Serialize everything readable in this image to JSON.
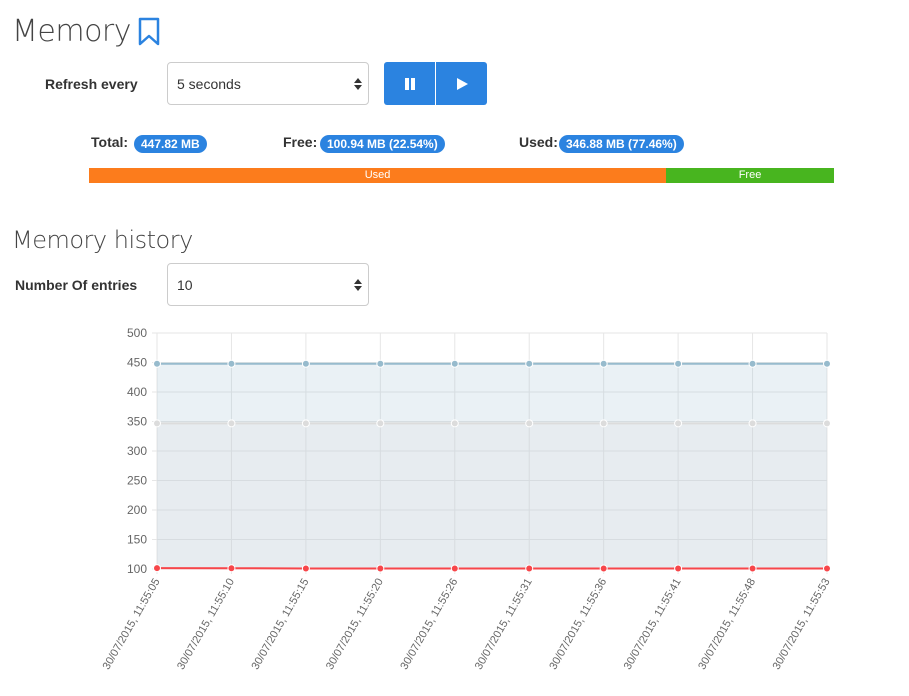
{
  "header": {
    "title": "Memory"
  },
  "refresh": {
    "label": "Refresh every",
    "value": "5 seconds"
  },
  "stats": {
    "total_label": "Total:",
    "total_value": "447.82 MB",
    "free_label": "Free:",
    "free_value": "100.94 MB (22.54%)",
    "used_label": "Used:",
    "used_value": "346.88 MB (77.46%)"
  },
  "usage_bar": {
    "used_label": "Used",
    "free_label": "Free",
    "used_percent": 77.46,
    "free_percent": 22.54
  },
  "history": {
    "title": "Memory history",
    "entries_label": "Number Of entries",
    "entries_value": "10"
  },
  "colors": {
    "accent": "#2b83e0",
    "used": "#fc7c1c",
    "free": "#48b51f"
  },
  "chart_data": {
    "type": "line",
    "x": [
      "30/07/2015, 11:55:05",
      "30/07/2015, 11:55:10",
      "30/07/2015, 11:55:15",
      "30/07/2015, 11:55:20",
      "30/07/2015, 11:55:26",
      "30/07/2015, 11:55:31",
      "30/07/2015, 11:55:36",
      "30/07/2015, 11:55:41",
      "30/07/2015, 11:55:48",
      "30/07/2015, 11:55:53"
    ],
    "ylim": [
      100,
      500
    ],
    "yticks": [
      500,
      450,
      400,
      350,
      300,
      250,
      200,
      150,
      100
    ],
    "grid": true,
    "series": [
      {
        "values": [
          447.82,
          447.82,
          447.82,
          447.82,
          447.82,
          447.82,
          447.82,
          447.82,
          447.82,
          447.82
        ],
        "color": "#97bbcd",
        "fill": true
      },
      {
        "values": [
          346.88,
          346.88,
          346.88,
          346.88,
          346.88,
          346.88,
          346.88,
          346.88,
          346.88,
          346.88
        ],
        "color": "#dcdcdc",
        "fill": true
      },
      {
        "values": [
          101.5,
          101.3,
          100.9,
          100.9,
          100.9,
          100.9,
          100.9,
          100.9,
          100.9,
          100.9
        ],
        "color": "#f7464a",
        "fill": false
      }
    ]
  }
}
